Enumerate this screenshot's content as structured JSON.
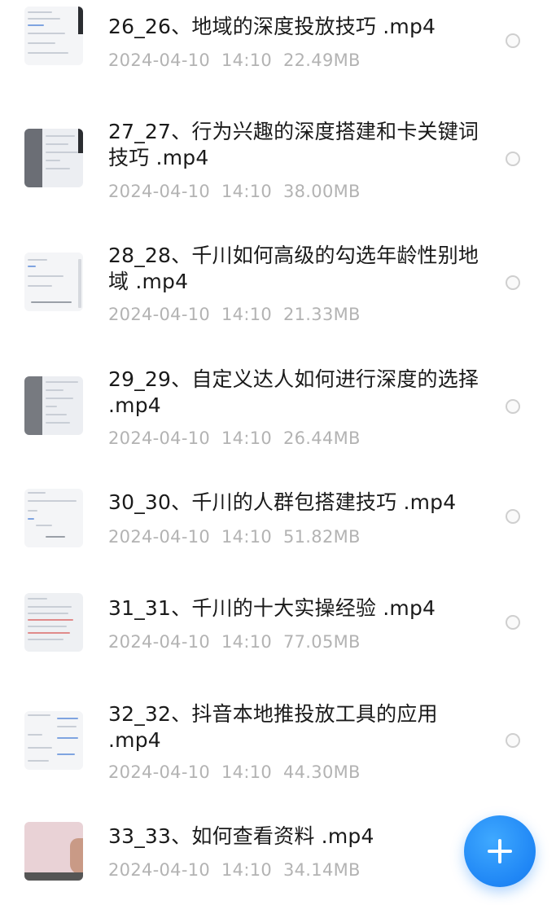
{
  "files": [
    {
      "title": "26_26、地域的深度投放技巧 .mp4",
      "date": "2024-04-10",
      "time": "14:10",
      "size": "22.49MB"
    },
    {
      "title": "27_27、行为兴趣的深度搭建和卡关键词技巧 .mp4",
      "date": "2024-04-10",
      "time": "14:10",
      "size": "38.00MB"
    },
    {
      "title": "28_28、千川如何高级的勾选年龄性别地域 .mp4",
      "date": "2024-04-10",
      "time": "14:10",
      "size": "21.33MB"
    },
    {
      "title": "29_29、自定义达人如何进行深度的选择 .mp4",
      "date": "2024-04-10",
      "time": "14:10",
      "size": "26.44MB"
    },
    {
      "title": "30_30、千川的人群包搭建技巧 .mp4",
      "date": "2024-04-10",
      "time": "14:10",
      "size": "51.82MB"
    },
    {
      "title": "31_31、千川的十大实操经验 .mp4",
      "date": "2024-04-10",
      "time": "14:10",
      "size": "77.05MB"
    },
    {
      "title": "32_32、抖音本地推投放工具的应用 .mp4",
      "date": "2024-04-10",
      "time": "14:10",
      "size": "44.30MB"
    },
    {
      "title": "33_33、如何查看资料 .mp4",
      "date": "2024-04-10",
      "time": "14:10",
      "size": "34.14MB"
    }
  ],
  "icons": {
    "fab": "plus-icon",
    "item_select": "radio-circle-icon",
    "thumbnail": "video-thumbnail"
  },
  "colors": {
    "accent": "#1f86f5",
    "title": "#1a1a1a",
    "meta": "#b3b3b3"
  }
}
